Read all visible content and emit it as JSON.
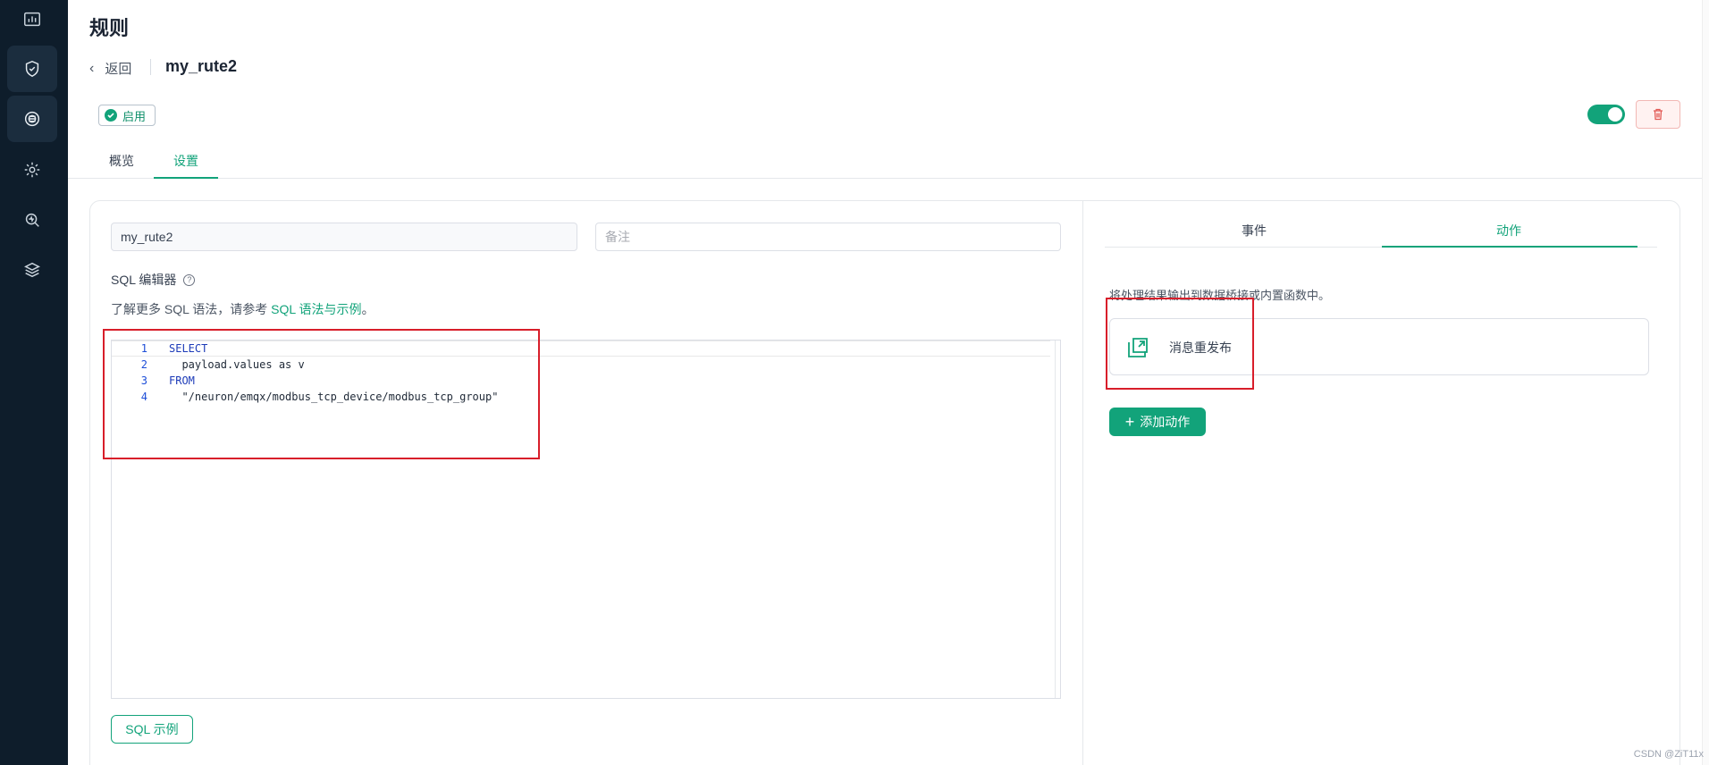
{
  "sidebar": {
    "items": [
      {
        "icon": "dashboard-icon"
      },
      {
        "icon": "shield-check-icon"
      },
      {
        "icon": "rule-engine-icon"
      },
      {
        "icon": "settings-gear-icon"
      },
      {
        "icon": "diagnose-search-icon"
      },
      {
        "icon": "layers-icon"
      }
    ]
  },
  "header": {
    "title": "规则",
    "back_label": "返回",
    "rule_name": "my_rute2",
    "status_label": "启用"
  },
  "tabs": [
    "概览",
    "设置"
  ],
  "form": {
    "name_value": "my_rute2",
    "remark_placeholder": "备注"
  },
  "sql": {
    "label": "SQL 编辑器",
    "help_symbol": "?",
    "hint_prefix": "了解更多 SQL 语法，请参考 ",
    "hint_link": "SQL 语法与示例",
    "hint_suffix": "。",
    "lines": [
      {
        "num": "1",
        "kw1": "SELECT",
        "text": ""
      },
      {
        "num": "2",
        "kw1": "",
        "text": "  payload.values as v"
      },
      {
        "num": "3",
        "kw1": "FROM",
        "text": ""
      },
      {
        "num": "4",
        "kw1": "",
        "text": "  \"/neuron/emqx/modbus_tcp_device/modbus_tcp_group\""
      }
    ],
    "example_button": "SQL 示例"
  },
  "right_panel": {
    "tabs": [
      "事件",
      "动作"
    ],
    "description": "将处理结果输出到数据桥接或内置函数中。",
    "action_card_label": "消息重发布",
    "add_action_label": "添加动作",
    "add_action_symbol": "+"
  },
  "watermark": "CSDN @ZiT11x",
  "colors": {
    "sidebar_bg": "#0e1d2b",
    "accent": "#12a37a",
    "annotation": "#d81e2a",
    "danger": "#e25a55"
  }
}
